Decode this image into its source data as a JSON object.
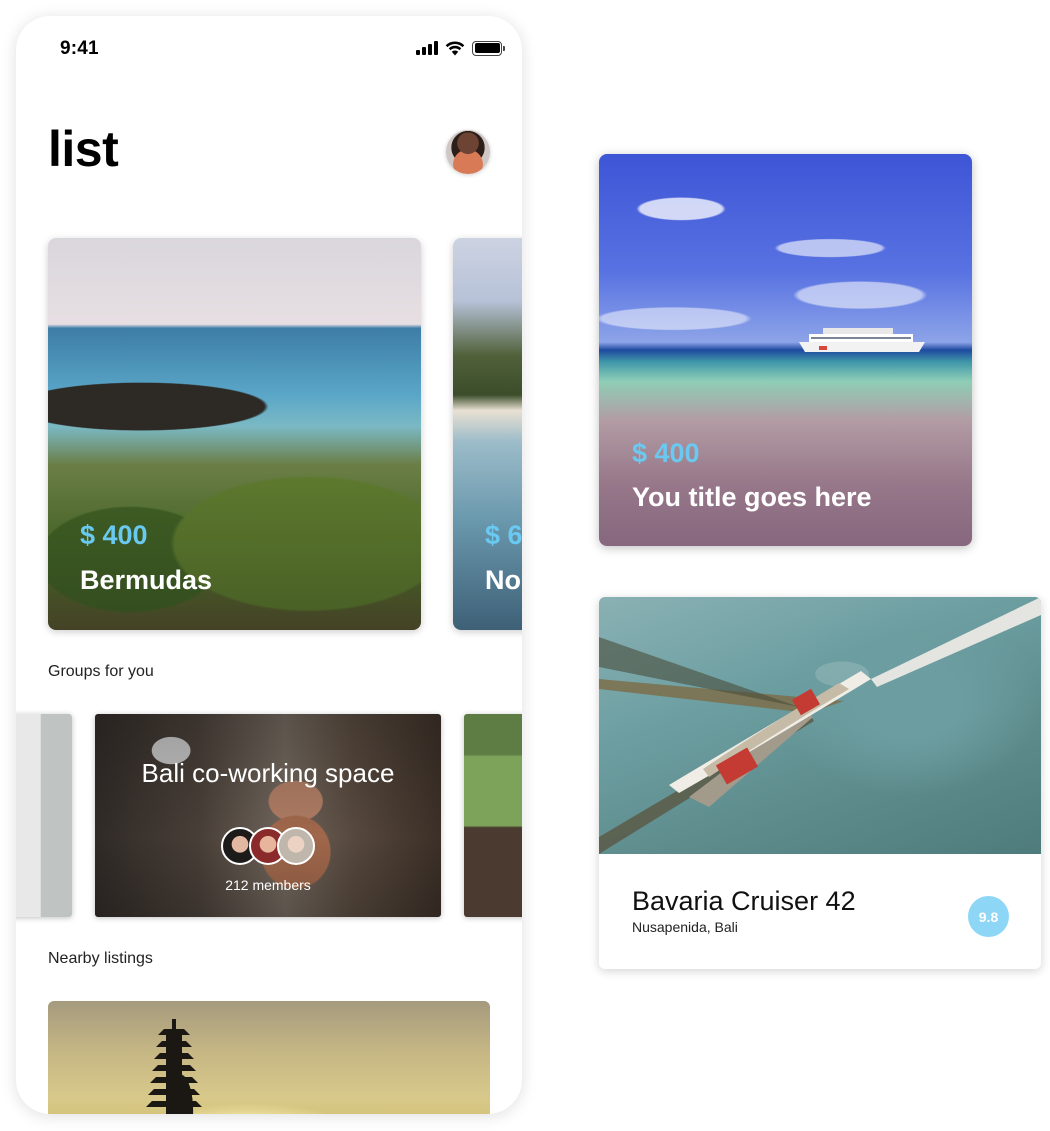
{
  "status_bar": {
    "time": "9:41"
  },
  "header": {
    "title": "list"
  },
  "destinations": [
    {
      "price": "$ 400",
      "name": "Bermudas"
    },
    {
      "price": "$ 6",
      "name": "No"
    }
  ],
  "sections": {
    "groups_label": "Groups for you",
    "nearby_label": "Nearby listings"
  },
  "group": {
    "title": "Bali co-working space",
    "members": "212 members"
  },
  "promo_card": {
    "price": "$ 400",
    "title": "You title goes here"
  },
  "boat_card": {
    "name": "Bavaria Cruiser 42",
    "location": "Nusapenida, Bali",
    "rating": "9.8"
  },
  "icons": [
    "signal-icon",
    "wifi-icon",
    "battery-icon"
  ],
  "colors": {
    "accent": "#6ac9f0",
    "badge": "#8ed6f6"
  }
}
